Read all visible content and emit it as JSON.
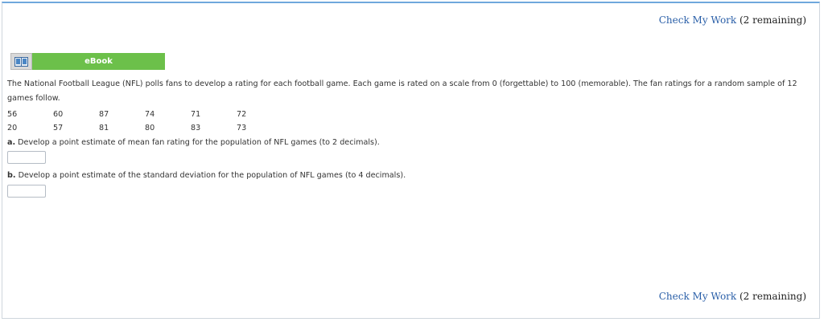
{
  "check_work_top": {
    "link": "Check My Work",
    "remaining": " (2 remaining)"
  },
  "check_work_bottom": {
    "link": "Check My Work",
    "remaining": " (2 remaining)"
  },
  "ebook": {
    "label": "eBook"
  },
  "problem_text": "The National Football League (NFL) polls fans to develop a rating for each football game. Each game is rated on a scale from 0 (forgettable) to 100 (memorable). The fan ratings for a random sample of 12 games follow.",
  "ratings": [
    [
      "56",
      "60",
      "87",
      "74",
      "71",
      "72"
    ],
    [
      "20",
      "57",
      "81",
      "80",
      "83",
      "73"
    ]
  ],
  "question_a": {
    "letter": "a.",
    "text": " Develop a point estimate of mean fan rating for the population of NFL games (to 2 decimals)."
  },
  "question_b": {
    "letter": "b.",
    "text": " Develop a point estimate of the standard deviation for the population of NFL games (to 4 decimals)."
  },
  "answer_a": {
    "value": ""
  },
  "answer_b": {
    "value": ""
  },
  "colors": {
    "ebook_green": "#6cc04a",
    "link_blue": "#2a5fa8",
    "frame_border": "#cfd6dd"
  },
  "icons": {
    "ebook": "book-icon"
  }
}
